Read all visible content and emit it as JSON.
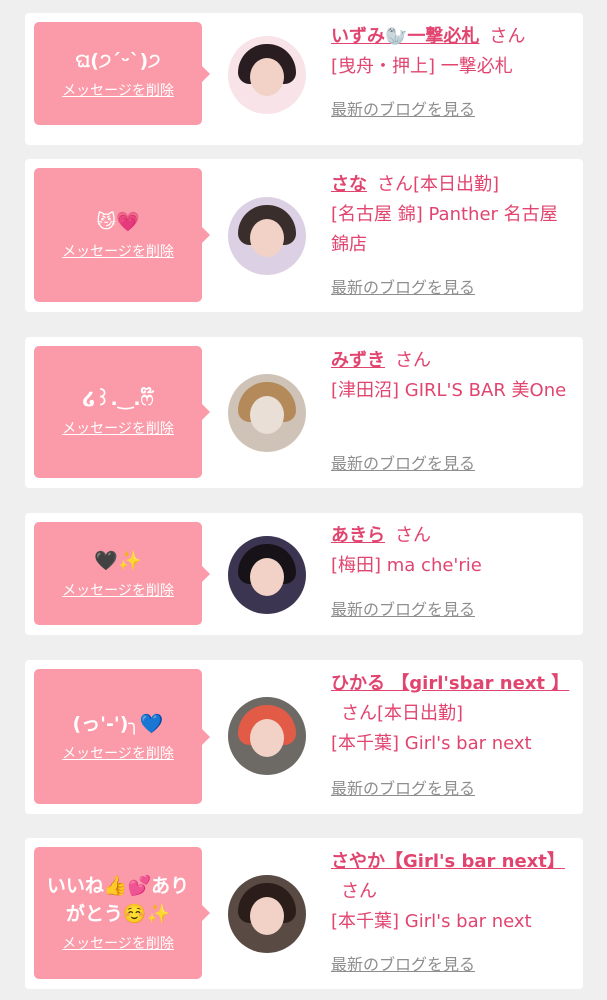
{
  "common": {
    "delete_label": "メッセージを削除",
    "blog_label": "最新のブログを見る",
    "san": "さん"
  },
  "colors": {
    "accent": "#e1456f",
    "bubble": "#fb9aa8",
    "background": "#efefef"
  },
  "entries": [
    {
      "message": "ଘ(੭ˊᵕˋ)੭",
      "name": "いずみ🦭一撃必札",
      "shop": "[曳舟・押上] 一撃必札"
    },
    {
      "message": "😼💗",
      "name": "さな",
      "suffix": "[本日出勤]",
      "shop": "[名古屋 錦] Panther 名古屋錦店"
    },
    {
      "message": "໒꒱.‿.ෆ໊",
      "name": "みずき",
      "shop": "[津田沼] GIRL'S BAR 美One"
    },
    {
      "message": "🖤✨",
      "name": "あきら",
      "shop": "[梅田] ma che'rie"
    },
    {
      "message": "(っ'-')╮💙",
      "name": "ひかる 【girl'sbar next 】",
      "suffix": "[本日出勤]",
      "shop": "[本千葉] Girl's bar next"
    },
    {
      "message": "いいね👍💕ありがとう☺️✨",
      "name": "さやか【Girl's bar next】",
      "shop": "[本千葉] Girl's bar next"
    }
  ]
}
